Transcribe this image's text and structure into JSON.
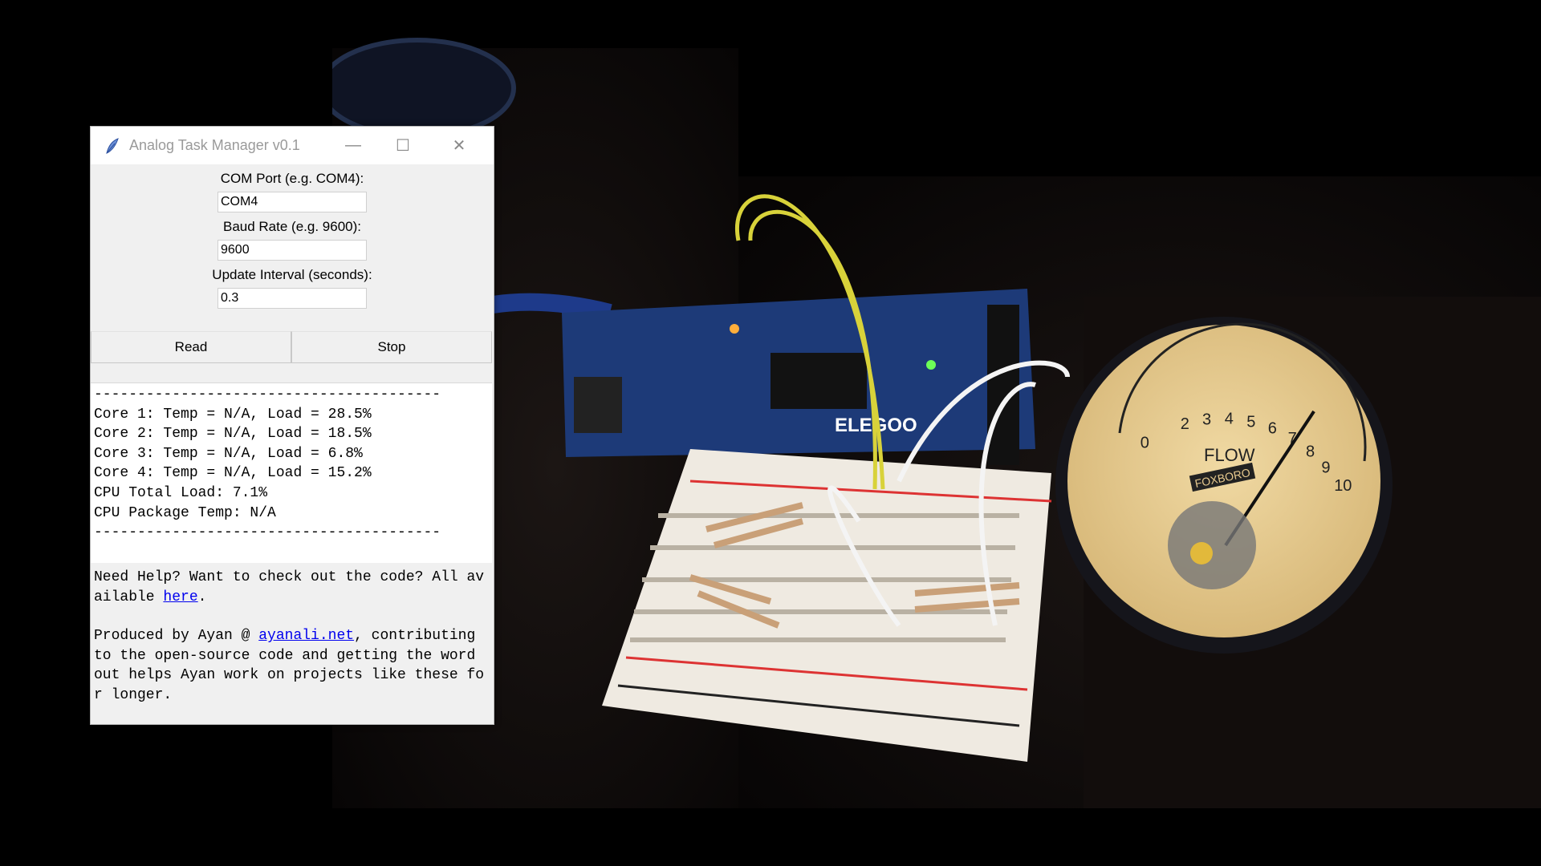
{
  "window": {
    "title": "Analog Task Manager v0.1",
    "min_glyph": "—",
    "max_glyph": "☐",
    "close_glyph": "✕"
  },
  "form": {
    "com_label": "COM Port (e.g. COM4):",
    "com_value": "COM4",
    "baud_label": "Baud Rate (e.g. 9600):",
    "baud_value": "9600",
    "interval_label": "Update Interval (seconds):",
    "interval_value": "0.3"
  },
  "buttons": {
    "read": "Read",
    "stop": "Stop"
  },
  "output": {
    "separator": "----------------------------------------",
    "lines": [
      "Core 1: Temp = N/A, Load = 28.5%",
      "Core 2: Temp = N/A, Load = 18.5%",
      "Core 3: Temp = N/A, Load = 6.8%",
      "Core 4: Temp = N/A, Load = 15.2%",
      "CPU Total Load: 7.1%",
      "CPU Package Temp: N/A"
    ]
  },
  "info": {
    "help_text": "Need Help? Want to check out the code? All available ",
    "help_link": "here",
    "help_end": ".",
    "credit_prefix": "Produced by Ayan @ ",
    "credit_link": "ayanali.net",
    "credit_rest": ", contributing to the open-source code and getting the word out helps Ayan work on projects like these for longer."
  },
  "meter": {
    "scale": [
      "0",
      "2",
      "3",
      "4",
      "5",
      "6",
      "7",
      "8",
      "9",
      "10"
    ],
    "label": "FLOW",
    "brand": "FOXBORO",
    "needle_value": 7.2
  },
  "colors": {
    "window_bg": "#f0f0f0",
    "link": "#0000ee",
    "meter_face": "#e7c98e",
    "board": "#1d3a78"
  }
}
